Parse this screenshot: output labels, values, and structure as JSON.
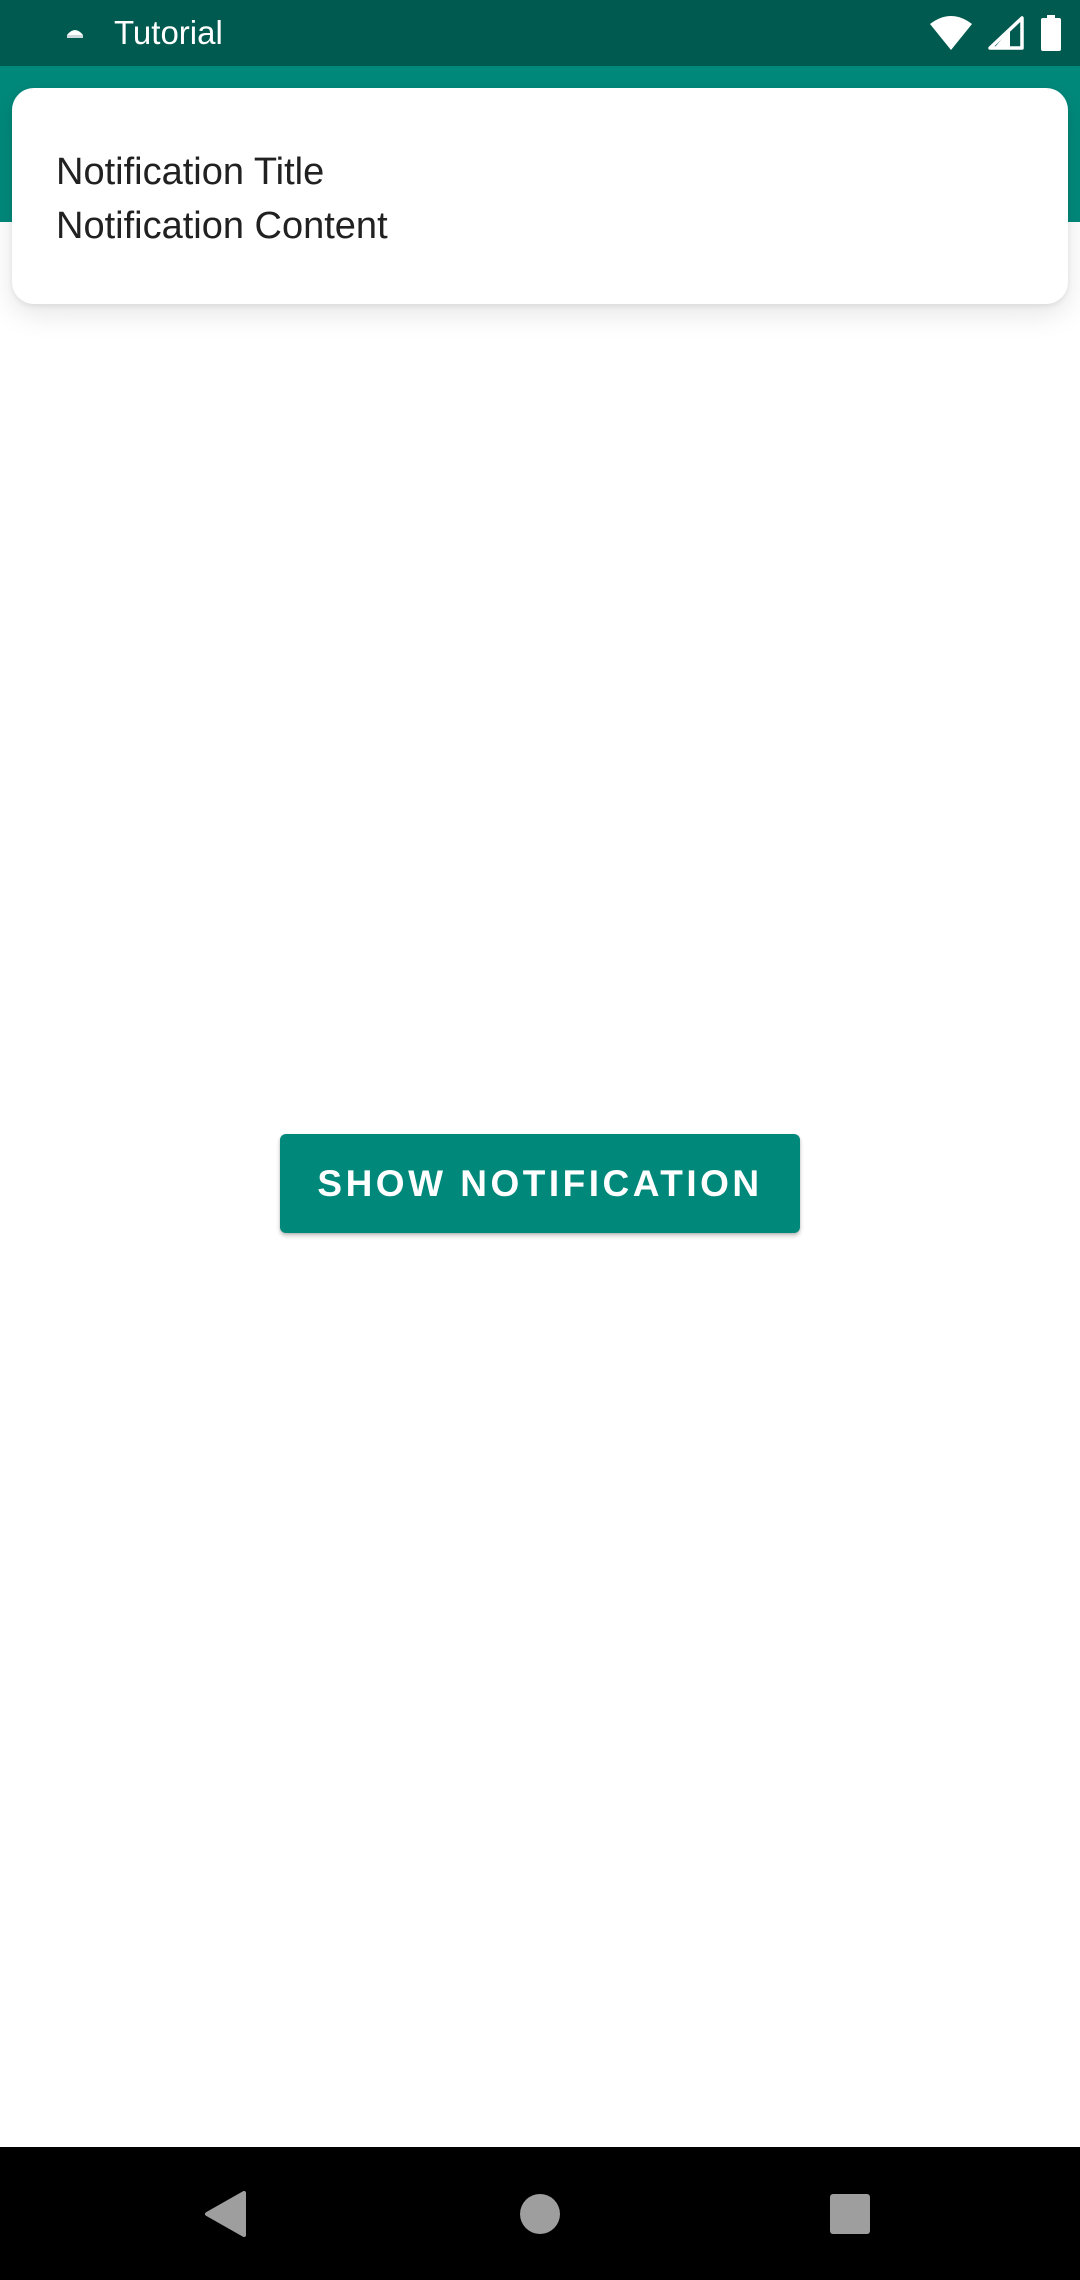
{
  "status_bar": {
    "app_title": "Tutorial",
    "background": "#005a4f",
    "app_icon": "tutorial-app-icon",
    "icons": [
      "wifi-icon",
      "cell-signal-icon",
      "battery-icon"
    ]
  },
  "app_bar": {
    "background": "#00897b"
  },
  "notification": {
    "title": "Notification Title",
    "content": "Notification Content"
  },
  "main": {
    "button_label": "SHOW NOTIFICATION",
    "button_color": "#00897b"
  },
  "nav_bar": {
    "icons": [
      "back-icon",
      "home-icon",
      "recents-icon"
    ]
  }
}
